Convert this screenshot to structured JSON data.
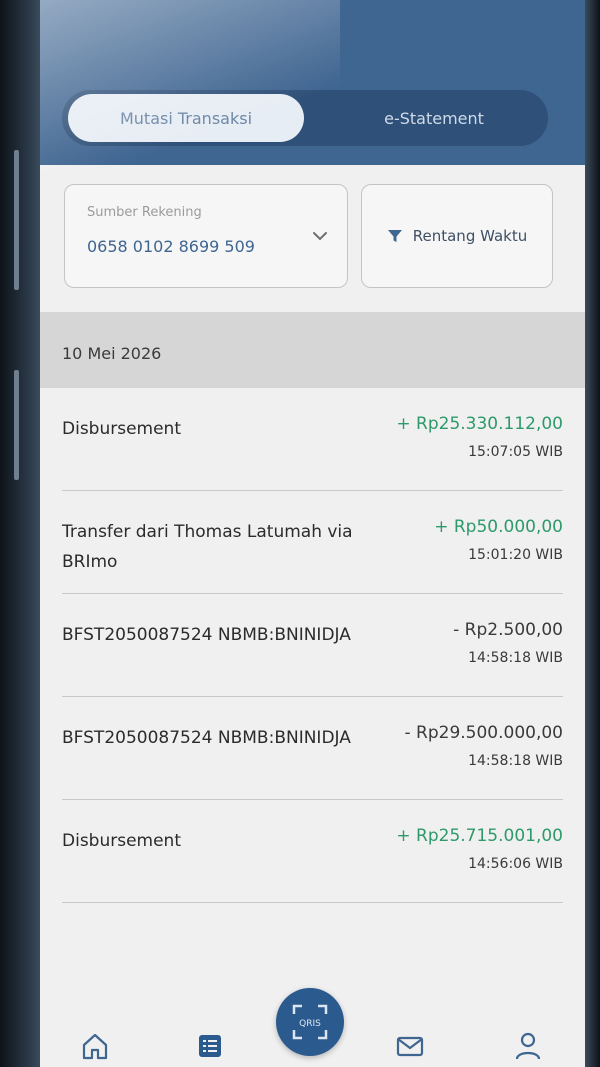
{
  "header": {
    "title": "",
    "tabs": [
      {
        "label": "Mutasi Transaksi",
        "active": true
      },
      {
        "label": "e-Statement",
        "active": false
      }
    ]
  },
  "filters": {
    "source_label": "Sumber Rekening",
    "source_value": "0658 0102 8699 509",
    "time_filter_label": "Rentang Waktu"
  },
  "date_group": "10 Mei 2026",
  "transactions": [
    {
      "title": "Disbursement",
      "amount": "+ Rp25.330.112,00",
      "time": "15:07:05 WIB",
      "type": "credit"
    },
    {
      "title": "Transfer dari Thomas Latumah via BRImo",
      "amount": "+ Rp50.000,00",
      "time": "15:01:20 WIB",
      "type": "credit"
    },
    {
      "title": "BFST2050087524 NBMB:BNINIDJA",
      "amount": "- Rp2.500,00",
      "time": "14:58:18 WIB",
      "type": "debit"
    },
    {
      "title": "BFST2050087524 NBMB:BNINIDJA",
      "amount": "- Rp29.500.000,00",
      "time": "14:58:18 WIB",
      "type": "debit"
    },
    {
      "title": "Disbursement",
      "amount": "+ Rp25.715.001,00",
      "time": "14:56:06 WIB",
      "type": "credit"
    }
  ],
  "bottom_nav": {
    "items": [
      {
        "icon": "home-icon"
      },
      {
        "icon": "list-icon"
      },
      {
        "icon": "qris-icon",
        "label": "QRIS"
      },
      {
        "icon": "mail-icon"
      },
      {
        "icon": "profile-icon"
      }
    ]
  },
  "colors": {
    "header": "#3f6591",
    "credit": "#2e9a6b",
    "debit": "#3a3a3a"
  }
}
